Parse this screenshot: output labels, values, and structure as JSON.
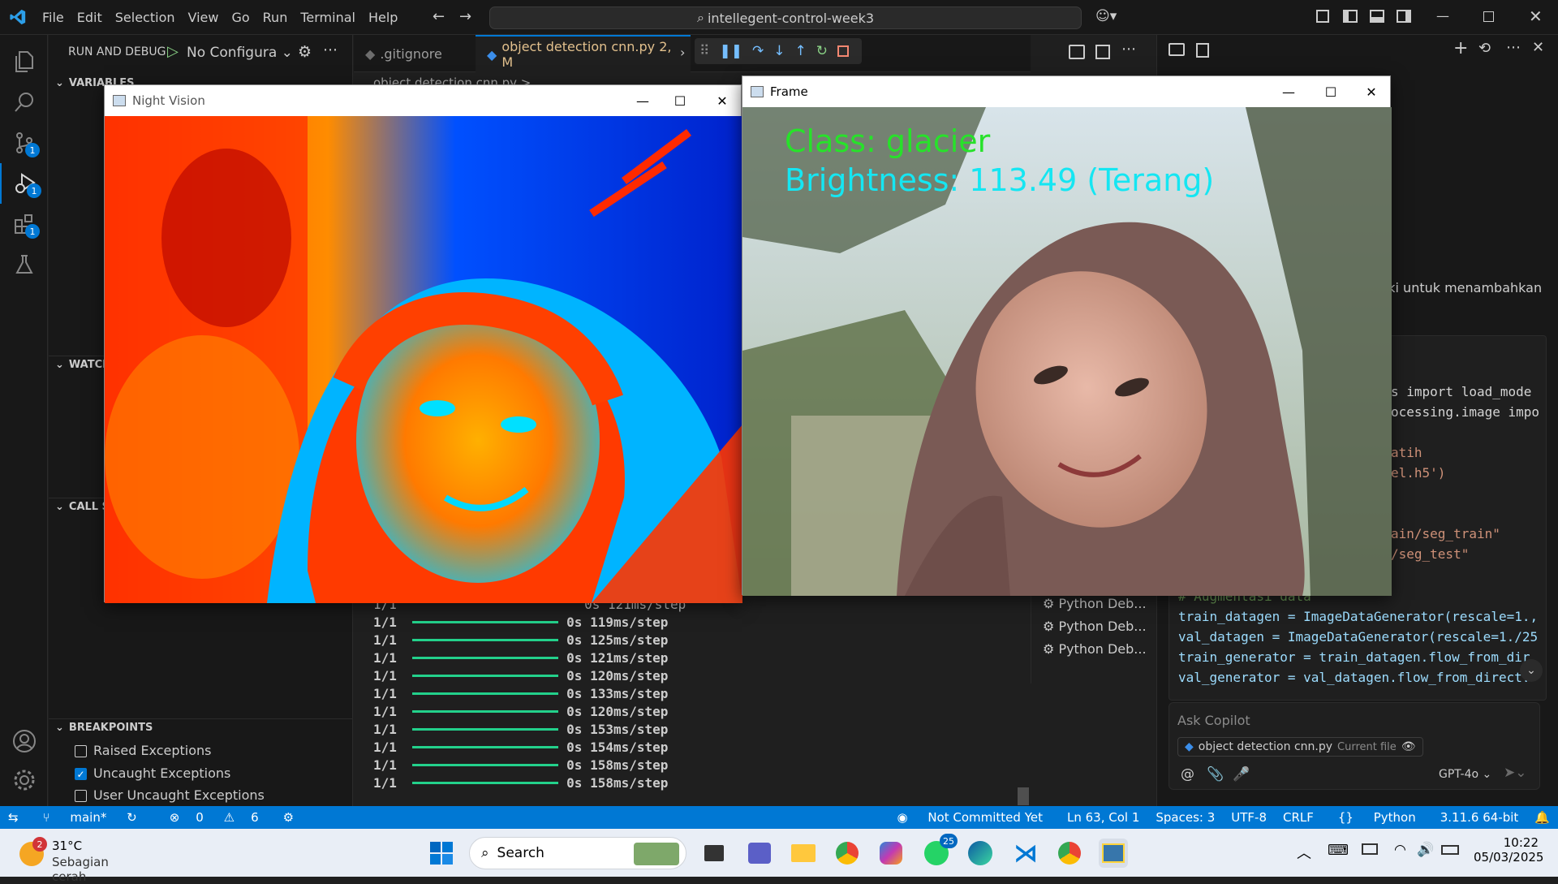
{
  "titlebar": {
    "menus": [
      "File",
      "Edit",
      "Selection",
      "View",
      "Go",
      "Run",
      "Terminal",
      "Help"
    ],
    "search_text": "intellegent-control-week3"
  },
  "activity": {
    "badges": {
      "scm": "1",
      "debug": "1",
      "extensions": "1"
    }
  },
  "sidebar": {
    "title": "RUN AND DEBUG",
    "config": "No Configura",
    "variables": "VARIABLES",
    "watch": "WATCH",
    "callstack": "CALL S",
    "breakpoints": "BREAKPOINTS",
    "bp_items": [
      {
        "label": "Raised Exceptions",
        "checked": false
      },
      {
        "label": "Uncaught Exceptions",
        "checked": true
      },
      {
        "label": "User Uncaught Exceptions",
        "checked": false
      }
    ]
  },
  "editor": {
    "tabs": [
      ".gitignore",
      "object detection cnn.py 2, M"
    ],
    "breadcrumb": "object detection cnn.py >"
  },
  "terminal": {
    "first_partial": "1/1                        0s 121ms/step",
    "lines": [
      {
        "step": "1/1",
        "time": "0s 119ms/step"
      },
      {
        "step": "1/1",
        "time": "0s 125ms/step"
      },
      {
        "step": "1/1",
        "time": "0s 121ms/step"
      },
      {
        "step": "1/1",
        "time": "0s 120ms/step"
      },
      {
        "step": "1/1",
        "time": "0s 133ms/step"
      },
      {
        "step": "1/1",
        "time": "0s 120ms/step"
      },
      {
        "step": "1/1",
        "time": "0s 153ms/step"
      },
      {
        "step": "1/1",
        "time": "0s 154ms/step"
      },
      {
        "step": "1/1",
        "time": "0s 158ms/step"
      },
      {
        "step": "1/1",
        "time": "0s 158ms/step"
      }
    ],
    "debug_items": [
      "Python Deb...",
      "Python Deb...",
      "Python Deb..."
    ]
  },
  "chat": {
    "partial_text": "aiki untuk menambahkan",
    "code_right": [
      "s import load_mode",
      "ocessing.image impo",
      "",
      "atih",
      "el.h5')",
      "",
      "",
      "ain/seg_train\"",
      "/seg_test\""
    ],
    "code_full": [
      "# Augmentasi data",
      "train_datagen = ImageDataGenerator(rescale=1.,",
      "val_datagen = ImageDataGenerator(rescale=1./25",
      "train_generator = train_datagen.flow_from_dir",
      "val_generator = val_datagen.flow_from_direct."
    ],
    "ask_placeholder": "Ask Copilot",
    "file_chip": "object detection cnn.py",
    "file_chip_tag": "Current file",
    "model": "GPT-4o"
  },
  "night_window": {
    "title": "Night Vision"
  },
  "frame_window": {
    "title": "Frame",
    "class_text": "Class: glacier",
    "brightness_text": "Brightness: 113.49 (Terang)"
  },
  "statusbar": {
    "branch": "main*",
    "errors": "0",
    "warnings": "6",
    "commit": "Not Committed Yet",
    "position": "Ln 63, Col 1",
    "spaces": "Spaces: 3",
    "encoding": "UTF-8",
    "eol": "CRLF",
    "language": "Python",
    "interpreter": "3.11.6 64-bit"
  },
  "taskbar": {
    "weather_temp": "31°C",
    "weather_desc": "Sebagian cerah",
    "weather_badge": "2",
    "search": "Search",
    "whatsapp_badge": "25",
    "time": "10:22",
    "date": "05/03/2025"
  }
}
